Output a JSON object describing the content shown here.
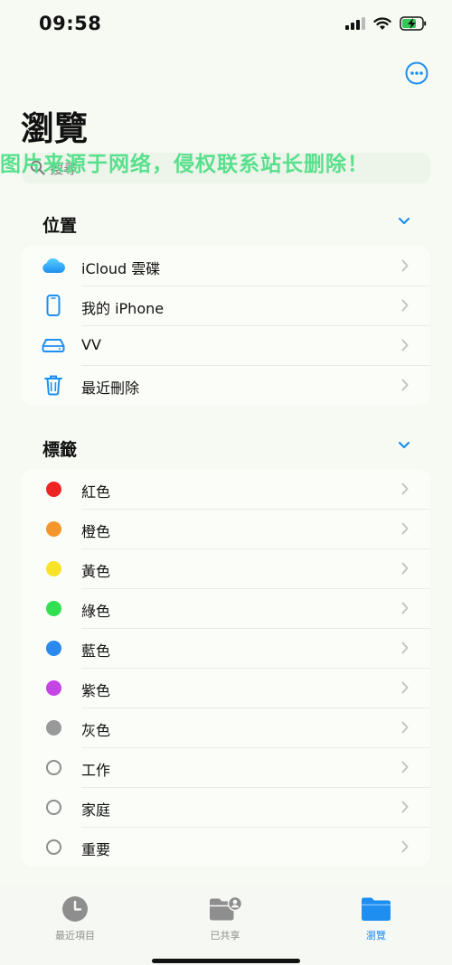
{
  "status_bar": {
    "time": "09:58"
  },
  "header": {
    "title": "瀏覽"
  },
  "watermark": "图片来源于网络，侵权联系站长删除！",
  "search": {
    "placeholder": "搜尋"
  },
  "sections": {
    "locations": {
      "title": "位置",
      "items": [
        {
          "label": "iCloud 雲碟",
          "icon": "icloud-icon"
        },
        {
          "label": "我的 iPhone",
          "icon": "iphone-icon"
        },
        {
          "label": "VV",
          "icon": "drive-icon"
        },
        {
          "label": "最近刪除",
          "icon": "trash-icon"
        }
      ]
    },
    "tags": {
      "title": "標籤",
      "items": [
        {
          "label": "紅色",
          "color": "#ee2525"
        },
        {
          "label": "橙色",
          "color": "#f5962a"
        },
        {
          "label": "黃色",
          "color": "#f8e32b"
        },
        {
          "label": "綠色",
          "color": "#30e050"
        },
        {
          "label": "藍色",
          "color": "#2a88ef"
        },
        {
          "label": "紫色",
          "color": "#c444e4"
        },
        {
          "label": "灰色",
          "color": "#999999"
        },
        {
          "label": "工作",
          "color": ""
        },
        {
          "label": "家庭",
          "color": ""
        },
        {
          "label": "重要",
          "color": ""
        }
      ]
    }
  },
  "tab_bar": {
    "tabs": [
      {
        "label": "最近項目",
        "icon": "clock-icon",
        "active": false
      },
      {
        "label": "已共享",
        "icon": "shared-folder-icon",
        "active": false
      },
      {
        "label": "瀏覽",
        "icon": "folder-icon",
        "active": true
      }
    ]
  },
  "colors": {
    "accent": "#1e8ef0",
    "background": "#f6faf2"
  }
}
